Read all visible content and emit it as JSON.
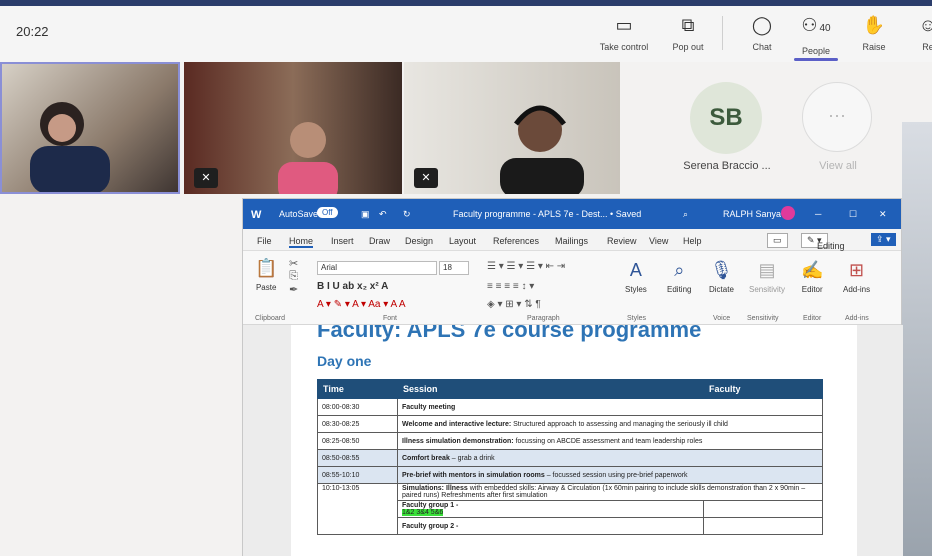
{
  "meeting": {
    "time": "20:22",
    "toolbar": [
      {
        "id": "take-control",
        "label": "Take control",
        "icon": "▭"
      },
      {
        "id": "pop-out",
        "label": "Pop out",
        "icon": "⧉"
      },
      {
        "id": "chat",
        "label": "Chat",
        "icon": "💬"
      },
      {
        "id": "people",
        "label": "People",
        "icon": "👥",
        "count": "40"
      },
      {
        "id": "raise",
        "label": "Raise",
        "icon": "✋"
      },
      {
        "id": "react",
        "label": "Re",
        "icon": "☺"
      }
    ],
    "participant_avatar": {
      "initials": "SB",
      "name": "Serena Braccio ..."
    },
    "view_all": {
      "icon": "···",
      "label": "View all"
    }
  },
  "word": {
    "title_bar": {
      "autosave": "AutoSave",
      "toggle": "Off",
      "doc_name": "Faculty programme - APLS 7e - Dest... • Saved",
      "user": "RALPH Sanya"
    },
    "menu": [
      "File",
      "Home",
      "Insert",
      "Draw",
      "Design",
      "Layout",
      "References",
      "Mailings",
      "Review",
      "View",
      "Help"
    ],
    "editing_label": "Editing",
    "font_name": "Arial",
    "font_size": "18",
    "ribbon_buttons": [
      "Styles",
      "Editing",
      "Dictate",
      "Sensitivity",
      "Editor",
      "Add-ins"
    ],
    "paste_label": "Paste",
    "groups": [
      "Clipboard",
      "Font",
      "Paragraph",
      "Styles",
      "Voice",
      "Sensitivity",
      "Editor",
      "Add-ins"
    ]
  },
  "document": {
    "heading": "Faculty: APLS 7e course programme",
    "subheading": "Day one",
    "columns": [
      "Time",
      "Session",
      "Faculty"
    ],
    "rows": [
      {
        "time": "08:00-08:30",
        "bold": "Faculty meeting",
        "text": "",
        "hl": false
      },
      {
        "time": "08:30-08:25",
        "bold": "Welcome and interactive lecture:",
        "text": "Structured approach to assessing and managing the seriously ill child",
        "hl": false
      },
      {
        "time": "08:25-08:50",
        "bold": "Illness simulation demonstration:",
        "text": "focussing on ABCDE assessment and team leadership roles",
        "hl": false
      },
      {
        "time": "08:50-08:55",
        "bold": "Comfort break",
        "text": "– grab a drink",
        "hl": true
      },
      {
        "time": "08:55-10:10",
        "bold": "Pre-brief with mentors in simulation rooms",
        "text": "– focussed session using pre-brief paperwork",
        "hl": true
      },
      {
        "time": "10:10-13:05",
        "bold": "Simulations: Illness",
        "text": "with embedded skills: Airway & Circulation (1x 60min pairing to include skills demonstration than 2 x 90min – paired runs) Refreshments after first simulation",
        "hl": false
      }
    ],
    "group1": "Faculty group 1 -",
    "group1_highlight": "1&2 3&4 5&6",
    "group2": "Faculty group 2 -"
  }
}
